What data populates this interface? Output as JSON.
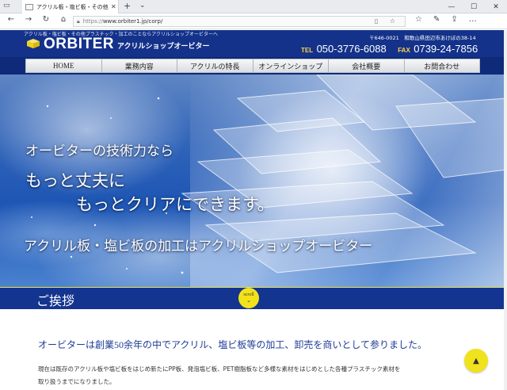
{
  "browser": {
    "tab_title": "アクリル板・塩ビ板・その他",
    "tab_close": "✕",
    "new_tab": "+",
    "tab_chevron": "⌄",
    "url_scheme": "https://",
    "url_rest": "www.orbiter1.jp/corp/",
    "controls": {
      "minimize": "—",
      "maximize": "☐",
      "close": "✕"
    },
    "nav": {
      "back": "←",
      "forward": "→",
      "refresh": "↻",
      "home": "⌂"
    },
    "addr_icons": "▯ ☆",
    "tools": [
      "☆",
      "✎",
      "⇪",
      "…"
    ]
  },
  "site": {
    "tagline": "アクリル板・塩ビ板・その他プラスチック・加工のことならアクリルショップオービターへ",
    "logo_text": "ORBITER",
    "logo_sub": "アクリルショップオービター",
    "address": "〒646-0021　和歌山県田辺市あけぼの38-14",
    "tel_label": "TEL",
    "tel": "050-3776-6088",
    "fax_label": "FAX",
    "fax": "0739-24-7856",
    "nav_items": [
      "HOME",
      "業務内容",
      "アクリルの特長",
      "オンラインショップ",
      "会社概要",
      "お問合わせ"
    ],
    "logo_color": "#f2d21b",
    "brand_blue": "#14328a"
  },
  "hero": {
    "line1": "オービターの技術力なら",
    "line2": "もっと丈夫に",
    "line3": "もっとクリアにできます。",
    "line4": "アクリル板・塩ビ板の加工はアクリルショップオービター",
    "scroll_label": "scroll",
    "scroll_arrow": "⌄"
  },
  "section": {
    "title": "ご挨拶",
    "lead": "オービターは創業50余年の中でアクリル、塩ビ板等の加工、卸売を商いとして参りました。",
    "body1": "現在は既存のアクリル板や塩ビ板をはじめ新たにPP板、発泡塩ビ板、PET樹脂板など多様な素材をはじめとした各種プラスチック素材を",
    "body2": "取り扱うまでになりました。",
    "to_top": "▲"
  }
}
